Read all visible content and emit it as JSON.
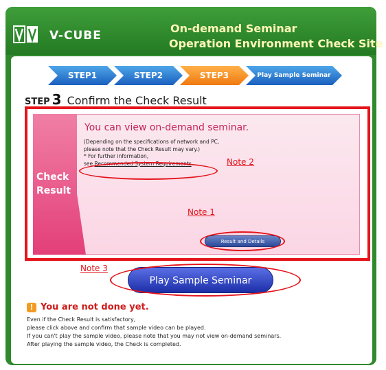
{
  "header": {
    "brand": "V-CUBE",
    "title_line1": "On-demand Seminar",
    "title_line2": "Operation Environment Check Site"
  },
  "steps": [
    {
      "label": "STEP1"
    },
    {
      "label": "STEP2"
    },
    {
      "label": "STEP3"
    },
    {
      "label": "Play Sample Seminar"
    }
  ],
  "section": {
    "step_word": "STEP",
    "step_number": "3",
    "title": "Confirm the Check Result"
  },
  "check": {
    "label_line1": "Check",
    "label_line2": "Result",
    "message": "You can view on-demand seminar.",
    "detail_line1": "(Depending on the specifications of network and PC,",
    "detail_line2": "please note that the Check Result may vary.)",
    "detail_line3": "* For further information,",
    "detail_line4_prefix": "see ",
    "detail_link": "Recommended System Requirements",
    "details_button": "Result and Details"
  },
  "notes": {
    "note1": "Note 1",
    "note2": "Note 2",
    "note3": "Note 3"
  },
  "play_button": "Play Sample Seminar",
  "warning": {
    "icon": "!",
    "title": "You are not done yet.",
    "lines": [
      "Even if the Check Result is satisfactory,",
      "please click above and confirm that sample video can be played.",
      "If you can't play the sample video, please note that you may not view on-demand seminars.",
      "After playing the sample video, the Check is completed."
    ]
  },
  "colors": {
    "header_green": "#2f8a2d",
    "accent_red": "#e5141b",
    "step_active": "#f07a10",
    "step_inactive": "#1a5fbf"
  }
}
